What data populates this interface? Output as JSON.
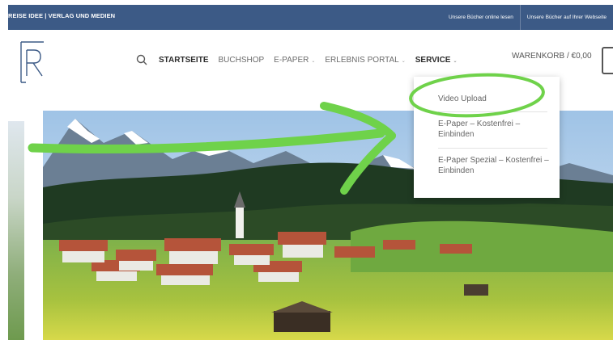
{
  "topbar": {
    "brand": "REISE IDEE | VERLAG UND MEDIEN",
    "links": [
      "Unsere Bücher online lesen",
      "Unsere Bücher auf Ihrer Webseite"
    ]
  },
  "nav": {
    "items": [
      {
        "label": "STARTSEITE",
        "has_dropdown": false
      },
      {
        "label": "BUCHSHOP",
        "has_dropdown": false
      },
      {
        "label": "E-PAPER",
        "has_dropdown": true
      },
      {
        "label": "ERLEBNIS PORTAL",
        "has_dropdown": true
      },
      {
        "label": "SERVICE",
        "has_dropdown": true
      }
    ],
    "cart": "WARENKORB / €0,00",
    "caret": "⌄"
  },
  "dropdown": {
    "items": [
      {
        "label": "Video Upload"
      },
      {
        "label": "E-Paper – Kostenfrei – Einbinden"
      },
      {
        "label": "E-Paper Spezial – Kostenfrei – Einbinden"
      }
    ]
  },
  "colors": {
    "topbar": "#3c5a86",
    "annotation": "#6fd24a"
  },
  "icons": {
    "search": "search-icon",
    "logo": "r-logo-icon"
  }
}
